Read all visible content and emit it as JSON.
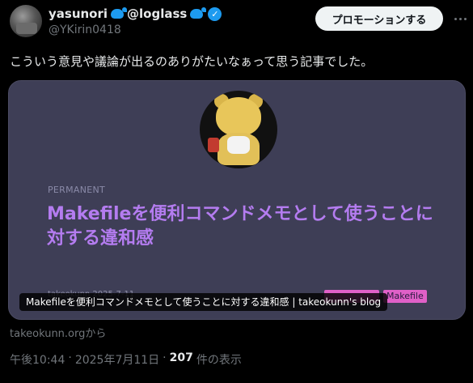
{
  "author": {
    "display_name": "yasunori",
    "display_name_suffix": "@loglass",
    "handle": "@YKirin0418",
    "verified": true
  },
  "actions": {
    "promote_label": "プロモーションする"
  },
  "tweet": {
    "text": "こういう意見や議論が出るのありがたいなぁって思う記事でした。"
  },
  "card": {
    "label": "PERMANENT",
    "title": "Makefileを便利コマンドメモとして使うことに対する違和感",
    "author_partial": "takeokunn  2025-7-11",
    "tag2": "Makefile",
    "caption": "Makefileを便利コマンドメモとして使うことに対する違和感 | takeokunn's blog",
    "domain_text": "takeokunn.orgから"
  },
  "meta": {
    "time": "午後10:44",
    "sep1": "·",
    "date": "2025年7月11日",
    "sep2": "·",
    "views_count": "207",
    "views_label": "件の表示"
  },
  "colors": {
    "accent": "#1d9bf0",
    "card_bg": "#3e3e56",
    "card_title": "#b47cf0",
    "tag": "#e060c8"
  }
}
